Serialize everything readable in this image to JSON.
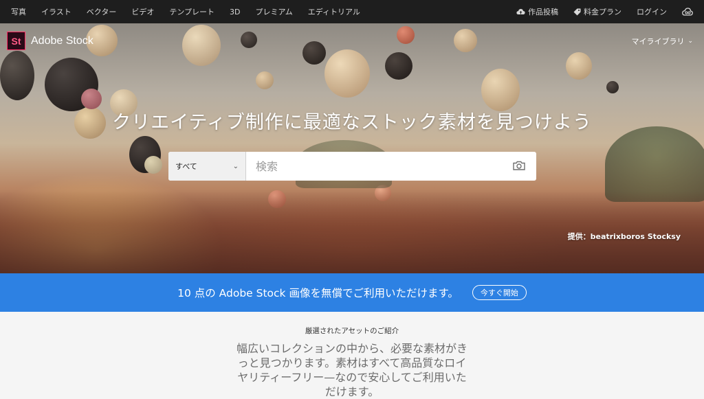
{
  "nav": {
    "left": [
      "写真",
      "イラスト",
      "ベクター",
      "ビデオ",
      "テンプレート",
      "3D",
      "プレミアム",
      "エディトリアル"
    ],
    "upload": "作品投稿",
    "pricing": "料金プラン",
    "login": "ログイン"
  },
  "brand": {
    "logo": "St",
    "name": "Adobe Stock"
  },
  "library": {
    "label": "マイライブラリ"
  },
  "hero": {
    "headline": "クリエイティブ制作に最適なストック素材を見つけよう",
    "credit": "提供：beatrixboros Stocksy"
  },
  "search": {
    "category": "すべて",
    "placeholder": "検索"
  },
  "promo": {
    "text": "10 点の Adobe Stock 画像を無償でご利用いただけます。",
    "button": "今すぐ開始"
  },
  "featured": {
    "title": "厳選されたアセットのご紹介",
    "description": "幅広いコレクションの中から、必要な素材がきっと見つかります。素材はすべて高品質なロイヤリティーフリー—なので安心してご利用いただけます。"
  },
  "colors": {
    "navbar": "#1e1e1e",
    "promo": "#2d81e3",
    "brand_accent": "#ff2f66"
  }
}
